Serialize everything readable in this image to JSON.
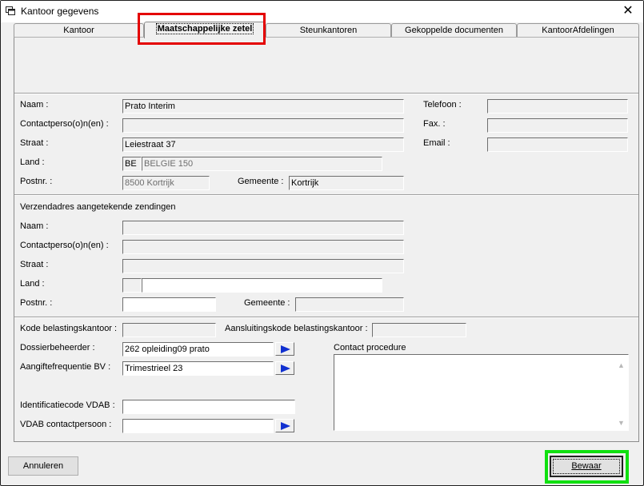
{
  "window": {
    "title": "Kantoor gegevens",
    "close_glyph": "✕"
  },
  "tabs": [
    {
      "label": "Kantoor"
    },
    {
      "label": "Maatschappelijke zetel"
    },
    {
      "label": "Steunkantoren"
    },
    {
      "label": "Gekoppelde documenten"
    },
    {
      "label": "KantoorAfdelingen"
    }
  ],
  "main_address": {
    "naam_label": "Naam :",
    "naam_value": "Prato Interim",
    "contact_label": "Contactperso(o)n(en) :",
    "contact_value": "",
    "straat_label": "Straat :",
    "straat_value": "Leiestraat 37",
    "land_label": "Land :",
    "land_code": "BE",
    "land_name": "BELGIE 150",
    "postnr_label": "Postnr. :",
    "postnr_value": "8500 Kortrijk",
    "gemeente_label": "Gemeente :",
    "gemeente_value": "Kortrijk",
    "telefoon_label": "Telefoon :",
    "telefoon_value": "",
    "fax_label": "Fax. :",
    "fax_value": "",
    "email_label": "Email :",
    "email_value": ""
  },
  "registered_mail": {
    "section_title": "Verzendadres aangetekende zendingen",
    "naam_label": "Naam :",
    "naam_value": "",
    "contact_label": "Contactperso(o)n(en) :",
    "contact_value": "",
    "straat_label": "Straat :",
    "straat_value": "",
    "land_label": "Land :",
    "land_code": "",
    "land_name": "",
    "postnr_label": "Postnr. :",
    "postnr_value": "",
    "gemeente_label": "Gemeente :",
    "gemeente_value": ""
  },
  "tax": {
    "kode_label": "Kode belastingskantoor :",
    "kode_value": "",
    "aansluiting_label": "Aansluitingskode belastingskantoor :",
    "aansluiting_value": "",
    "dossier_label": "Dossierbeheerder :",
    "dossier_value": "262 opleiding09 prato",
    "aangifte_label": "Aangiftefrequentie BV :",
    "aangifte_value": "Trimestrieel 23",
    "vdab_code_label": "Identificatiecode VDAB :",
    "vdab_code_value": "",
    "vdab_contact_label": "VDAB contactpersoon :",
    "vdab_contact_value": "",
    "contact_procedure_label": "Contact procedure",
    "contact_procedure_value": ""
  },
  "footer": {
    "cancel_label": "Annuleren",
    "save_label": "Bewaar"
  },
  "colors": {
    "highlight_red": "#e40000",
    "highlight_green": "#10e010",
    "arrow_blue": "#1030d0"
  }
}
